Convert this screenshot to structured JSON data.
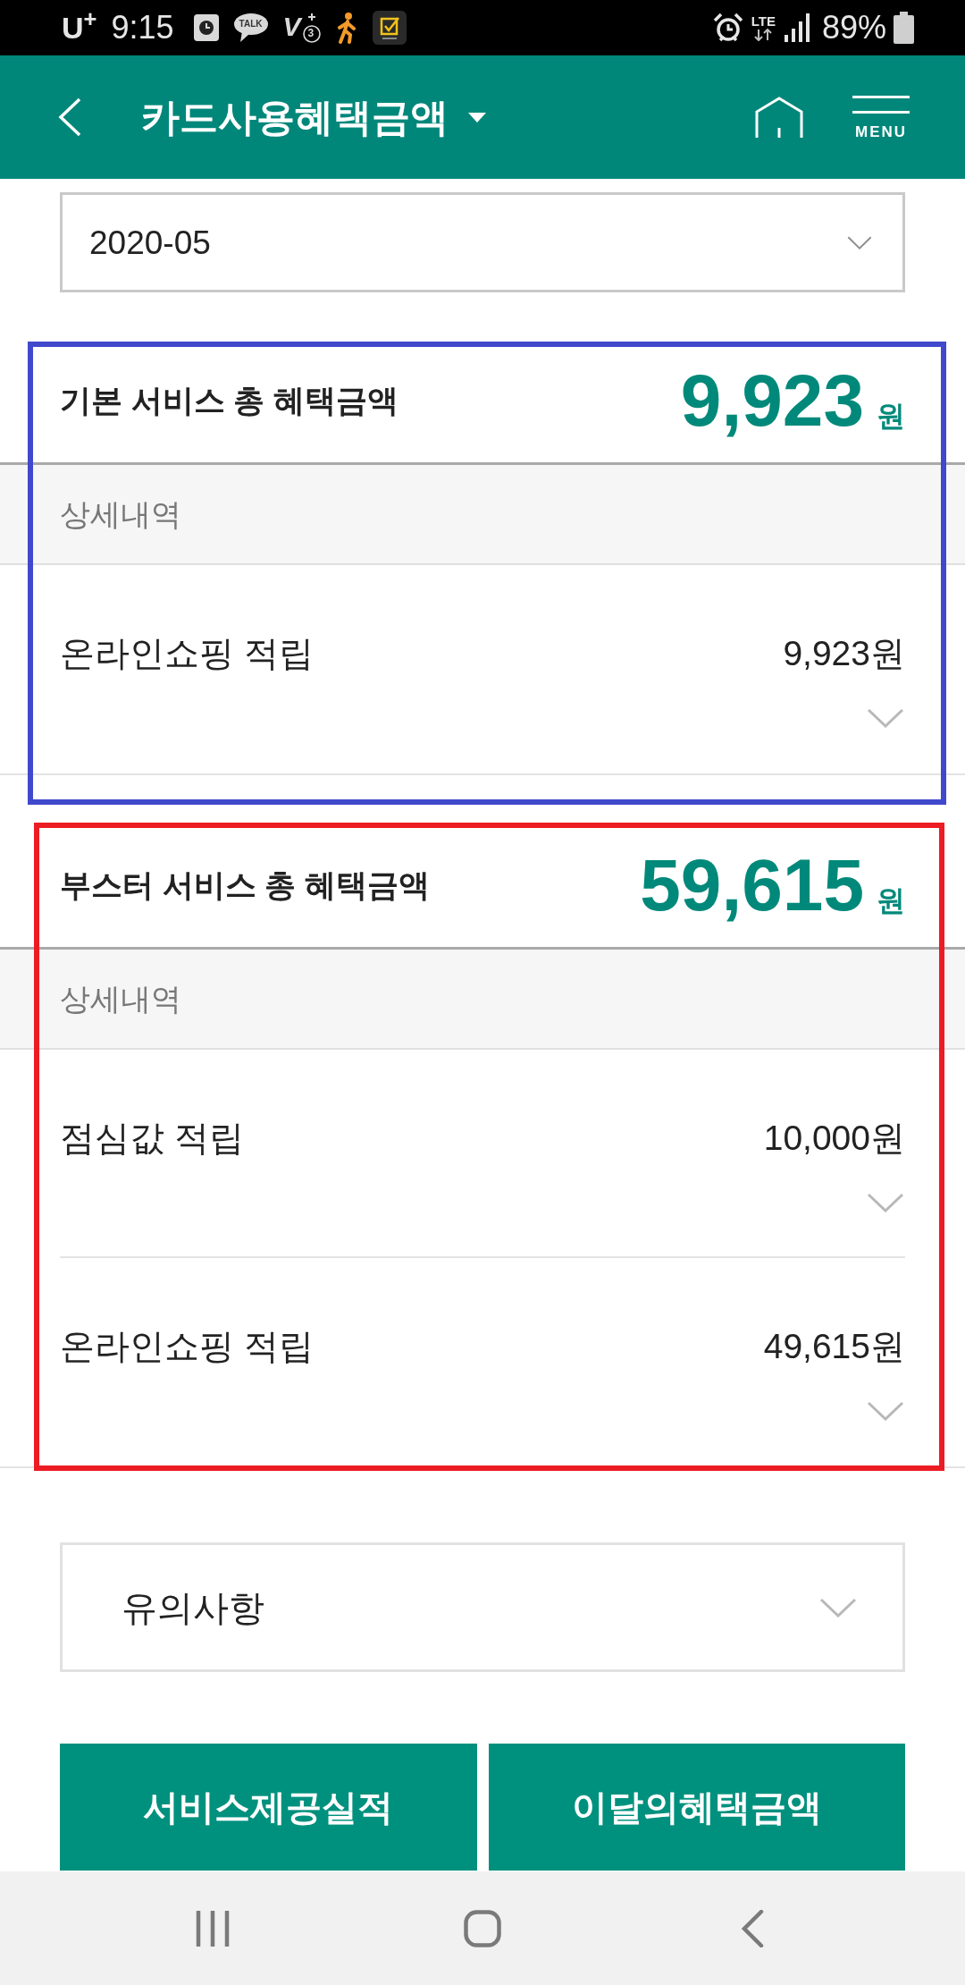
{
  "status_bar": {
    "carrier": "U$^{+}$",
    "time": "9:15",
    "notifications": [
      {
        "kind": "clock"
      },
      {
        "kind": "chat",
        "label": "TALK"
      },
      {
        "kind": "antivirus",
        "label": "V",
        "badge": "3"
      },
      {
        "kind": "walker"
      },
      {
        "kind": "checklist"
      }
    ],
    "network": "LTE",
    "battery": "89%"
  },
  "header": {
    "title": "카드사용혜택금액",
    "menu_label": "MENU"
  },
  "month_select": {
    "value": "2020-05"
  },
  "sections": [
    {
      "title": "기본 서비스 총 혜택금액",
      "total": "9,923",
      "unit": "원",
      "detail_label": "상세내역",
      "highlight": {
        "color": "#4048cc"
      },
      "items": [
        {
          "name": "온라인쇼핑 적립",
          "amount": "9,923원",
          "expanded": false
        }
      ]
    },
    {
      "title": "부스터 서비스 총 혜택금액",
      "total": "59,615",
      "unit": "원",
      "detail_label": "상세내역",
      "highlight": {
        "color": "#ec1c24"
      },
      "items": [
        {
          "name": "점심값 적립",
          "amount": "10,000원",
          "expanded": false
        },
        {
          "name": "온라인쇼핑 적립",
          "amount": "49,615원",
          "expanded": false
        }
      ]
    }
  ],
  "notice": {
    "label": "유의사항",
    "expanded": false
  },
  "buttons": [
    "서비스제공실적",
    "이달의혜택금액"
  ]
}
